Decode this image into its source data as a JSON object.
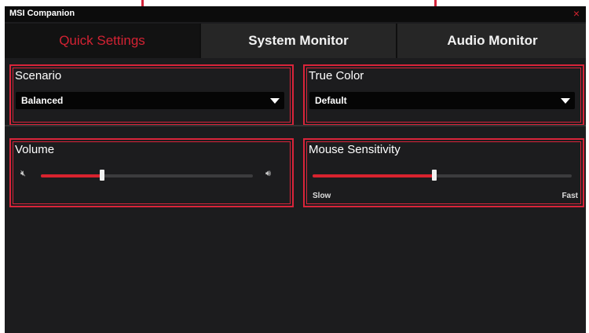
{
  "window": {
    "title": "MSI Companion",
    "close_glyph": "×"
  },
  "tabs": [
    {
      "label": "Quick Settings",
      "active": true
    },
    {
      "label": "System Monitor",
      "active": false
    },
    {
      "label": "Audio Monitor",
      "active": false
    }
  ],
  "scenario": {
    "title": "Scenario",
    "selected": "Balanced",
    "icon": "chevron-down-icon"
  },
  "true_color": {
    "title": "True Color",
    "selected": "Default",
    "icon": "chevron-down-icon"
  },
  "volume": {
    "title": "Volume",
    "level_percent": 29,
    "mute_icon": "speaker-mute-icon",
    "max_icon": "speaker-loud-icon"
  },
  "mouse_sensitivity": {
    "title": "Mouse Sensitivity",
    "level_percent": 47,
    "min_label": "Slow",
    "max_label": "Fast"
  },
  "colors": {
    "accent": "#d8232e",
    "background": "#1c1c1e",
    "callout": "#d9243a"
  }
}
